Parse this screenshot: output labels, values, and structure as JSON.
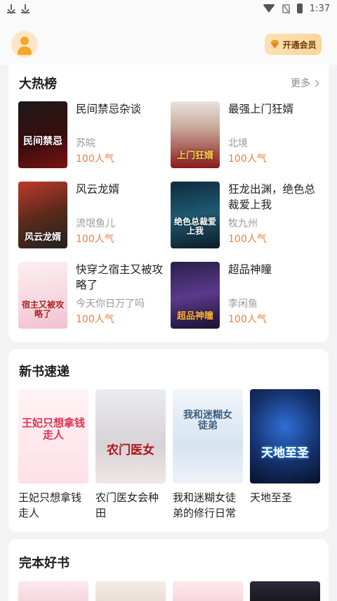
{
  "status_bar": {
    "time": "1:37"
  },
  "header": {
    "vip_label": "开通会员"
  },
  "hot": {
    "title": "大热榜",
    "more_label": "更多",
    "items": [
      {
        "title": "民间禁忌杂谈",
        "author": "苏皖",
        "popularity": "100人气",
        "cover_text": "民间禁忌"
      },
      {
        "title": "最强上门狂婿",
        "author": "北境",
        "popularity": "100人气",
        "cover_text": "上门狂婿"
      },
      {
        "title": "风云龙婿",
        "author": "流氓鱼儿",
        "popularity": "100人气",
        "cover_text": "风云龙婿"
      },
      {
        "title": "狂龙出渊，绝色总裁爱上我",
        "author": "牧九州",
        "popularity": "100人气",
        "cover_text": "绝色总裁爱上我"
      },
      {
        "title": "快穿之宿主又被攻略了",
        "author": "今天你日万了吗",
        "popularity": "100人气",
        "cover_text": "宿主又被攻略了"
      },
      {
        "title": "超品神瞳",
        "author": "李闲鱼",
        "popularity": "100人气",
        "cover_text": "超品神瞳"
      }
    ]
  },
  "new_books": {
    "title": "新书速递",
    "items": [
      {
        "title": "王妃只想拿钱走人",
        "cover_text": "王妃只想拿钱走人"
      },
      {
        "title": "农门医女会种田",
        "cover_text": "农门医女"
      },
      {
        "title": "我和迷糊女徒弟的修行日常",
        "cover_text": "我和迷糊女徒弟"
      },
      {
        "title": "天地至圣",
        "cover_text": "天地至圣"
      }
    ]
  },
  "completed": {
    "title": "完本好书"
  },
  "colors": {
    "accent": "#f07e3a",
    "vip_bg": "#fbd59a",
    "avatar": "#f5a623"
  }
}
